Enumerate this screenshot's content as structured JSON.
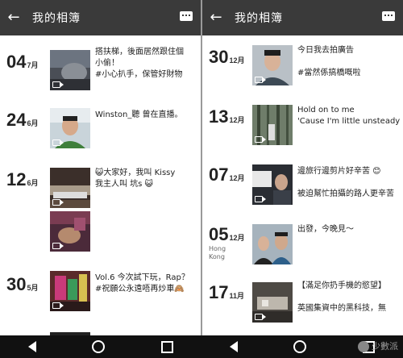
{
  "left": {
    "title": "我的相簿",
    "entries": [
      {
        "day": "04",
        "month": "7月",
        "caption": "搭扶梯，後面居然跟住個\n小偷！\n#小心扒手，保管好財物"
      },
      {
        "day": "24",
        "month": "6月",
        "caption": "Winston_聽 曾在直播。"
      },
      {
        "day": "12",
        "month": "6月",
        "caption": "😺大家好，我叫 Kissy\n我主人叫 坑s 😺"
      },
      {
        "day": "30",
        "month": "5月",
        "caption": "Vol.6 今次試下玩，Rap？\n#祝願公永遠唔再炒車🙈"
      }
    ]
  },
  "right": {
    "title": "我的相簿",
    "entries": [
      {
        "day": "30",
        "month": "12月",
        "caption": "今日我去拍廣告\n\n#當然係搞橋嘅啦"
      },
      {
        "day": "13",
        "month": "12月",
        "caption": "Hold on to me\n'Cause I'm little unsteady"
      },
      {
        "day": "07",
        "month": "12月",
        "caption": "邊旅行邊剪片好辛苦 😊\n\n被迫幫忙拍攝的路人更辛苦"
      },
      {
        "day": "05",
        "month": "12月",
        "location": "Hong\nKong",
        "caption": "出發，今晚見〜"
      },
      {
        "day": "17",
        "month": "11月",
        "caption": "【滿足你扔手機的慾望】\n\n英國集資中的黑科技，無"
      }
    ]
  },
  "watermark": "少數派"
}
